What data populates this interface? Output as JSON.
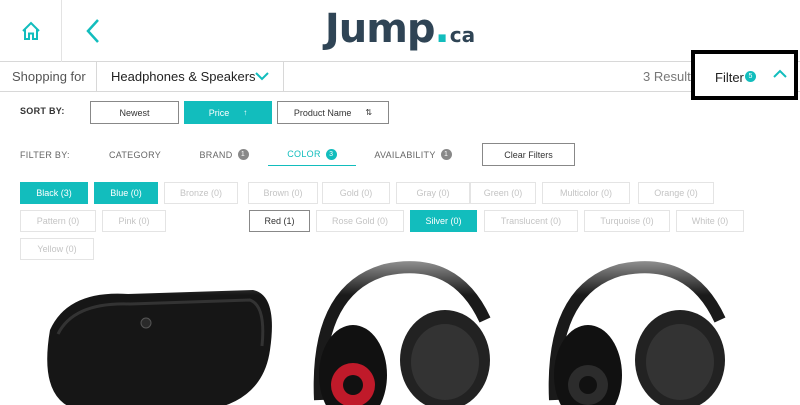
{
  "header": {
    "logo_main": "Jump",
    "logo_dot": ".",
    "logo_tld": "ca",
    "icons": {
      "home": "home-icon",
      "back": "chevron-left-icon"
    }
  },
  "shopbar": {
    "label": "Shopping for",
    "category": "Headphones & Speakers",
    "results": "3 Results",
    "filter_label": "Filter",
    "filter_count": "5"
  },
  "sort": {
    "label": "SORT BY:",
    "options": [
      "Newest",
      "Price",
      "Product Name"
    ],
    "active": "Price",
    "price_arrow": "↑",
    "name_arrow": "⇅"
  },
  "filter": {
    "label": "FILTER BY:",
    "tabs": {
      "category": "CATEGORY",
      "brand": "BRAND",
      "brand_count": "1",
      "color": "COLOR",
      "color_count": "3",
      "availability": "AVAILABILITY",
      "availability_count": "1"
    },
    "clear": "Clear Filters"
  },
  "colors": {
    "black": "Black (3)",
    "blue": "Blue (0)",
    "bronze": "Bronze (0)",
    "brown": "Brown (0)",
    "gold": "Gold (0)",
    "gray": "Gray (0)",
    "green": "Green (0)",
    "multicolor": "Multicolor (0)",
    "orange": "Orange (0)",
    "pattern": "Pattern (0)",
    "pink": "Pink (0)",
    "red": "Red (1)",
    "rose_gold": "Rose Gold (0)",
    "silver": "Silver (0)",
    "translucent": "Translucent (0)",
    "turquoise": "Turquoise (0)",
    "white": "White (0)",
    "yellow": "Yellow (0)"
  },
  "colors_theme": {
    "accent": "#12bdbd",
    "logo": "#2f4455",
    "dark": "#222222"
  }
}
